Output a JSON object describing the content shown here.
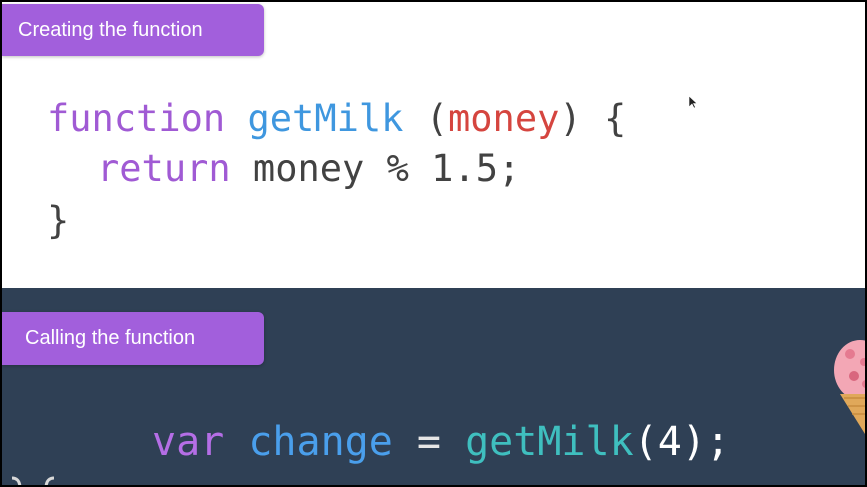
{
  "top_label": "Creating the function",
  "bottom_label": "Calling the function",
  "function_def": {
    "line1": {
      "keyword": "function",
      "name": "getMilk",
      "open_paren": " (",
      "param": "money",
      "close": ") {"
    },
    "line2": {
      "keyword": "return",
      "expr": " money % 1.5;"
    },
    "line3": {
      "close_brace": "}"
    }
  },
  "function_call": {
    "keyword": "var",
    "var_name": "change",
    "equals": " = ",
    "fn_name": "getMilk",
    "args": "(4);"
  },
  "colors": {
    "tab_bg": "#a25fdc",
    "bottom_bg": "#2f4055",
    "keyword": "#a05ad4",
    "function_name": "#3f97df",
    "parameter": "#d5453f",
    "call_function": "#3fbfbf"
  },
  "icons": [
    "cursor-icon",
    "ice-cream-icon",
    "brace-icon"
  ]
}
